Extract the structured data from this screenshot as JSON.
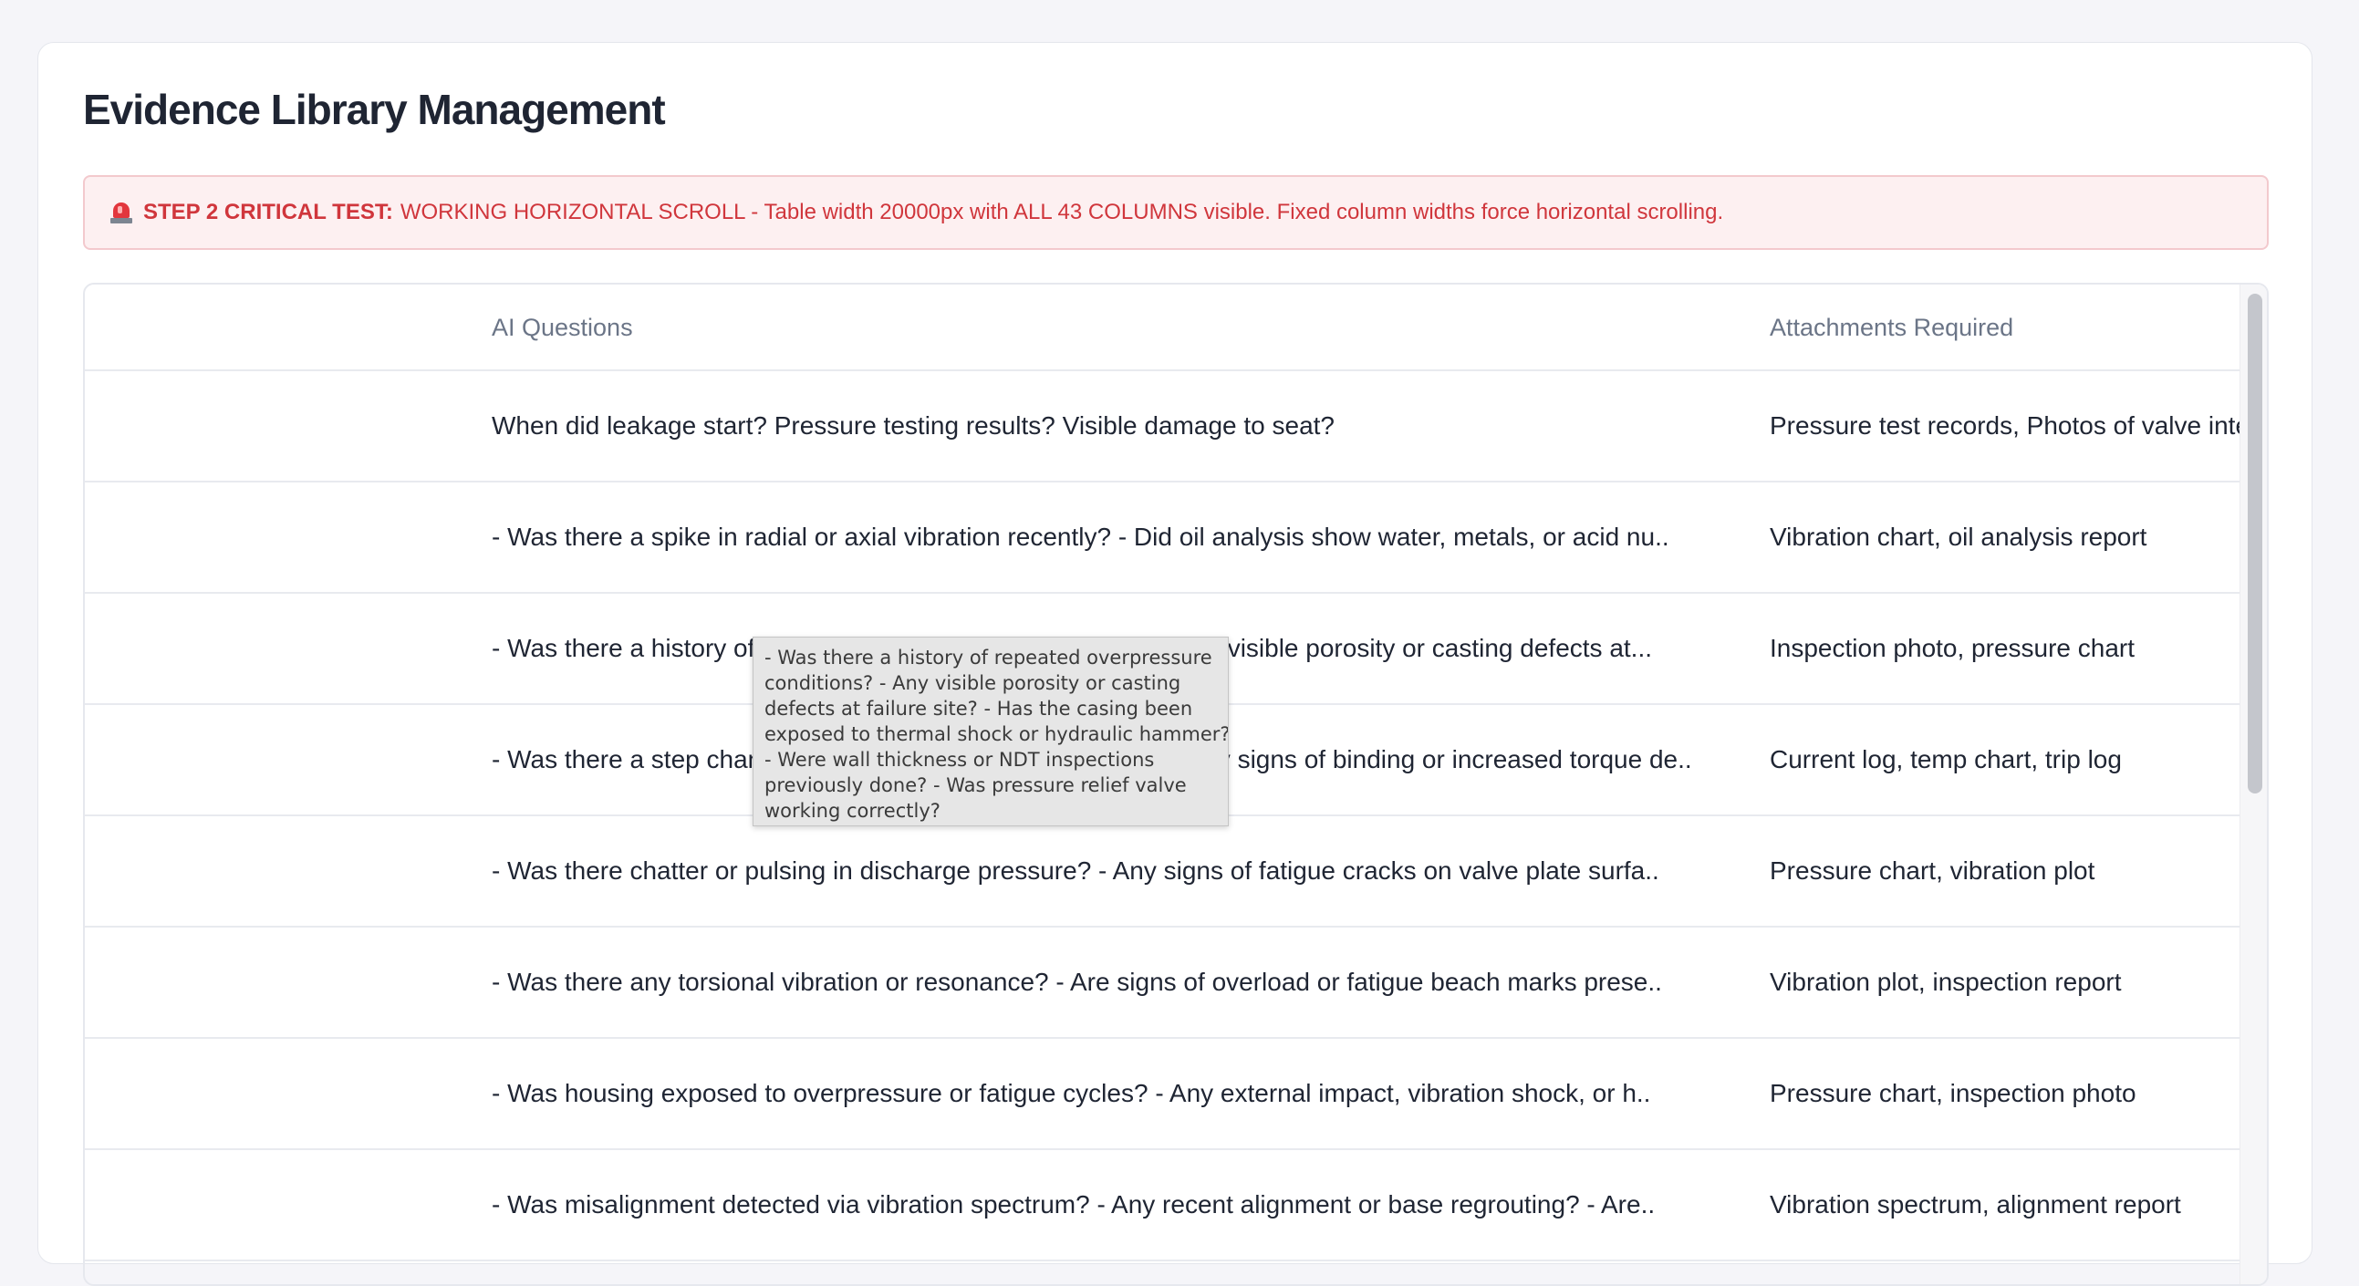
{
  "page": {
    "title": "Evidence Library Management"
  },
  "alert": {
    "icon": "siren-icon",
    "label": "STEP 2 CRITICAL TEST:",
    "message": "WORKING HORIZONTAL SCROLL - Table width 20000px with ALL 43 COLUMNS visible. Fixed column widths force horizontal scrolling.",
    "color": "#d0363c",
    "background": "#fdf0f1"
  },
  "table": {
    "headers": {
      "ai_questions": "AI Questions",
      "attachments_required": "Attachments Required"
    },
    "rows": [
      {
        "ai_questions": "When did leakage start? Pressure testing results? Visible damage to seat?",
        "attachments_required": "Pressure test records, Photos of valve inter"
      },
      {
        "ai_questions": "- Was there a spike in radial or axial vibration recently? - Did oil analysis show water, metals, or acid nu..",
        "attachments_required": "Vibration chart, oil analysis report"
      },
      {
        "ai_questions": "- Was there a history of repeated overpressure conditions? - Any visible porosity or casting defects at...",
        "attachments_required": "Inspection photo, pressure chart"
      },
      {
        "ai_questions": "- Was there a step change in motor current or temperature? - Any signs of binding or increased torque de..",
        "attachments_required": "Current log, temp chart, trip log"
      },
      {
        "ai_questions": "- Was there chatter or pulsing in discharge pressure? - Any signs of fatigue cracks on valve plate surfa..",
        "attachments_required": "Pressure chart, vibration plot"
      },
      {
        "ai_questions": "- Was there any torsional vibration or resonance? - Are signs of overload or fatigue beach marks prese..",
        "attachments_required": "Vibration plot, inspection report"
      },
      {
        "ai_questions": "- Was housing exposed to overpressure or fatigue cycles? - Any external impact, vibration shock, or h..",
        "attachments_required": "Pressure chart, inspection photo"
      },
      {
        "ai_questions": "- Was misalignment detected via vibration spectrum? - Any recent alignment or base regrouting? - Are..",
        "attachments_required": "Vibration spectrum, alignment report"
      }
    ]
  },
  "tooltip": {
    "lines": [
      "- Was there a history of repeated overpressure",
      "conditions? - Any visible porosity or casting",
      "defects at failure site? - Has the casing been",
      "exposed to thermal shock or hydraulic hammer?",
      "- Were wall thickness or NDT inspections",
      "previously done? - Was pressure relief valve",
      "working correctly?"
    ]
  }
}
